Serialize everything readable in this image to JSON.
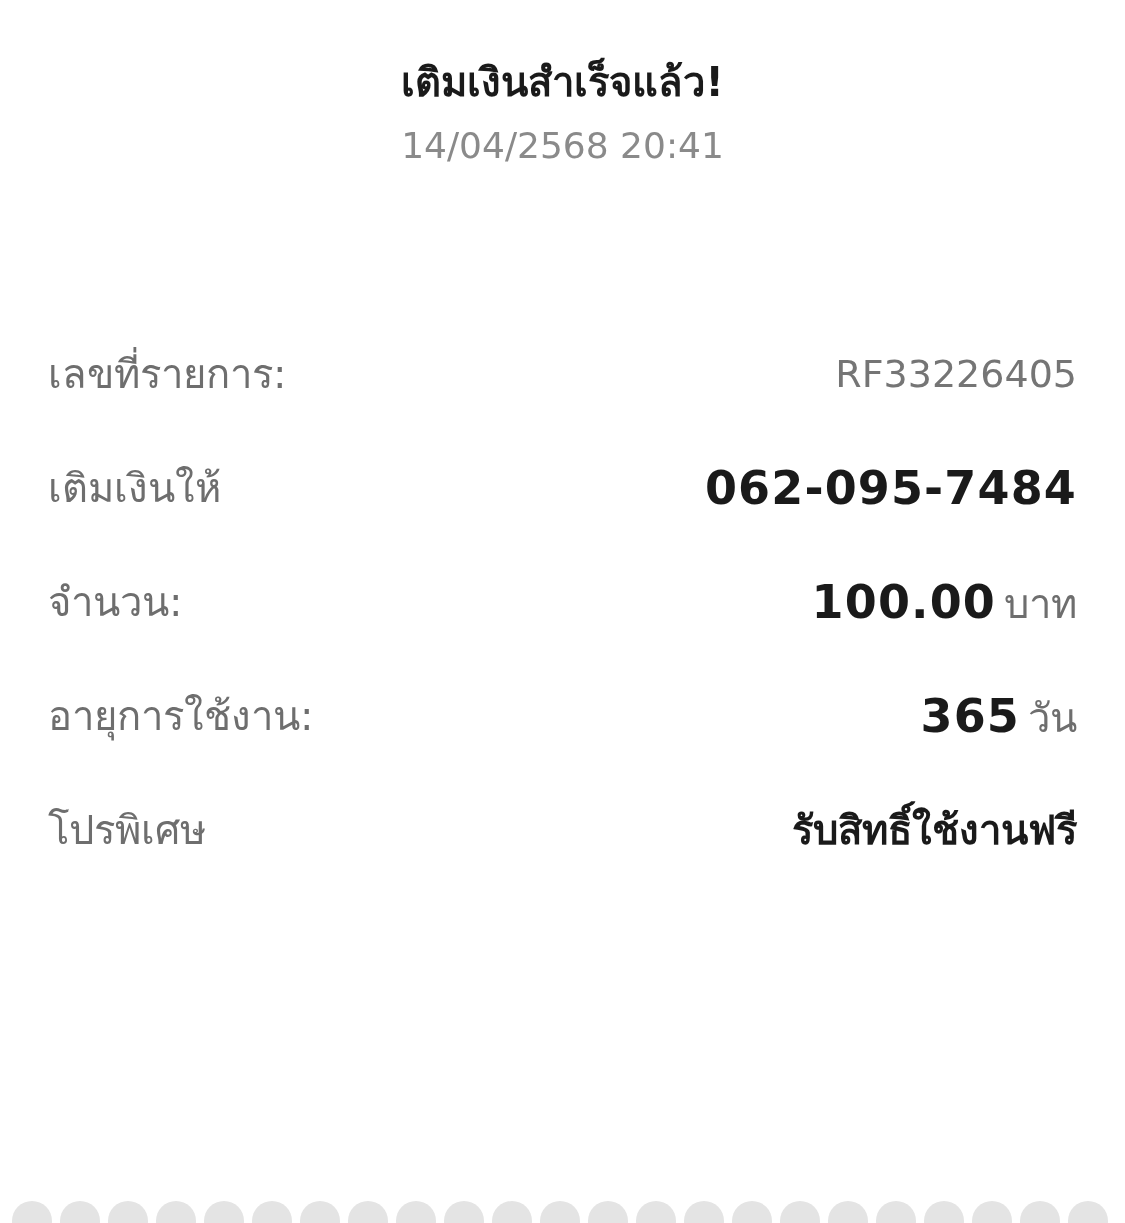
{
  "title": "เติมเงินสำเร็จแล้ว!",
  "datetime": "14/04/2568 20:41",
  "rows": [
    {
      "kind": "plain",
      "label": "เลขที่รายการ:",
      "value": "RF33226405"
    },
    {
      "kind": "bold",
      "label": "เติมเงินให้",
      "value": "062-095-7484"
    },
    {
      "kind": "bold",
      "label": "จำนวน:",
      "value": "100.00",
      "unit": "บาท"
    },
    {
      "kind": "bold",
      "label": "อายุการใช้งาน:",
      "value": "365",
      "unit": "วัน"
    },
    {
      "kind": "emphasis",
      "label": "โปรพิเศษ",
      "value": "รับสิทธิ์ใช้งานฟรี"
    }
  ]
}
